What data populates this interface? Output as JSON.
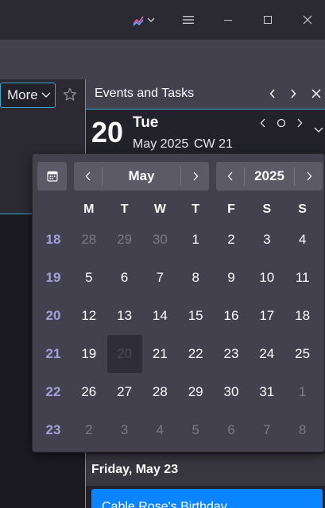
{
  "titlebar": {
    "activity_icon": "activity-chart-icon",
    "menu_icon": "hamburger-icon",
    "minimize_icon": "minimize-icon",
    "maximize_icon": "maximize-icon",
    "close_icon": "close-icon"
  },
  "message_toolbar": {
    "more_label": "More",
    "star_icon": "star-icon"
  },
  "today_pane": {
    "title": "Events and Tasks",
    "day_number": "20",
    "weekday": "Tue",
    "month_year": "May 2025",
    "calendar_week": "CW 21",
    "section_header": "Friday, May 23",
    "event_title": "Cable Rose's Birthday"
  },
  "minimonth": {
    "month": "May",
    "year": "2025",
    "weekday_headers": [
      "M",
      "T",
      "W",
      "T",
      "F",
      "S",
      "S"
    ],
    "weeks": [
      {
        "week": "18",
        "days": [
          {
            "d": "28",
            "other": true
          },
          {
            "d": "29",
            "other": true
          },
          {
            "d": "30",
            "other": true
          },
          {
            "d": "1"
          },
          {
            "d": "2"
          },
          {
            "d": "3"
          },
          {
            "d": "4"
          }
        ]
      },
      {
        "week": "19",
        "days": [
          {
            "d": "5"
          },
          {
            "d": "6"
          },
          {
            "d": "7"
          },
          {
            "d": "8"
          },
          {
            "d": "9"
          },
          {
            "d": "10"
          },
          {
            "d": "11"
          }
        ]
      },
      {
        "week": "20",
        "days": [
          {
            "d": "12"
          },
          {
            "d": "13"
          },
          {
            "d": "14"
          },
          {
            "d": "15"
          },
          {
            "d": "16"
          },
          {
            "d": "17"
          },
          {
            "d": "18"
          }
        ]
      },
      {
        "week": "21",
        "days": [
          {
            "d": "19"
          },
          {
            "d": "20",
            "selected": true
          },
          {
            "d": "21"
          },
          {
            "d": "22"
          },
          {
            "d": "23"
          },
          {
            "d": "24"
          },
          {
            "d": "25"
          }
        ]
      },
      {
        "week": "22",
        "days": [
          {
            "d": "26"
          },
          {
            "d": "27"
          },
          {
            "d": "28"
          },
          {
            "d": "29"
          },
          {
            "d": "30"
          },
          {
            "d": "31"
          },
          {
            "d": "1",
            "other": true
          }
        ]
      },
      {
        "week": "23",
        "days": [
          {
            "d": "2",
            "other": true
          },
          {
            "d": "3",
            "other": true
          },
          {
            "d": "4",
            "other": true
          },
          {
            "d": "5",
            "other": true
          },
          {
            "d": "6",
            "other": true
          },
          {
            "d": "7",
            "other": true
          },
          {
            "d": "8",
            "other": true
          }
        ]
      }
    ]
  },
  "colors": {
    "accent": "#3aa9c9",
    "event_blue": "#0a84ff",
    "week_number": "#a39fdc"
  }
}
